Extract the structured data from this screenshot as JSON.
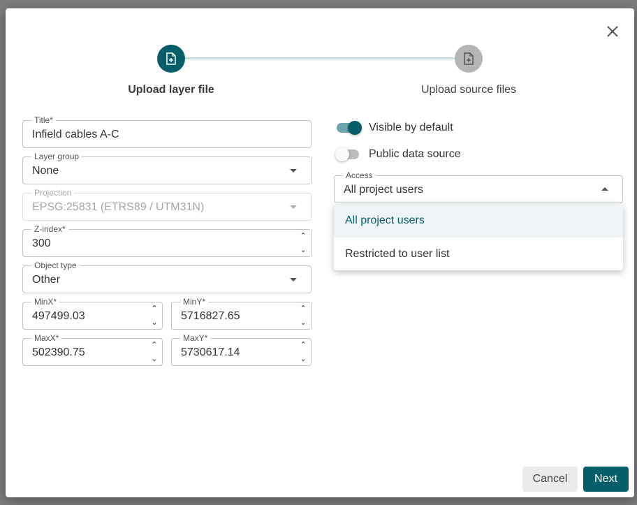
{
  "stepper": {
    "steps": [
      {
        "label": "Upload layer file",
        "state": "active",
        "icon": "file-plus-icon"
      },
      {
        "label": "Upload source files",
        "state": "inactive",
        "icon": "file-plus-icon"
      }
    ]
  },
  "form": {
    "title": {
      "label": "Title*",
      "value": "Infield cables A-C"
    },
    "layer_group": {
      "label": "Layer group",
      "value": "None"
    },
    "projection": {
      "label": "Projection",
      "value": "EPSG:25831 (ETRS89 / UTM31N)",
      "disabled": true
    },
    "z_index": {
      "label": "Z-index*",
      "value": "300"
    },
    "object_type": {
      "label": "Object type",
      "value": "Other"
    },
    "min_x": {
      "label": "MinX*",
      "value": "497499.03"
    },
    "min_y": {
      "label": "MinY*",
      "value": "5716827.65"
    },
    "max_x": {
      "label": "MaxX*",
      "value": "502390.75"
    },
    "max_y": {
      "label": "MaxY*",
      "value": "5730617.14"
    }
  },
  "options": {
    "visible_by_default": {
      "label": "Visible by default",
      "checked": true
    },
    "public_data_source": {
      "label": "Public data source",
      "checked": false
    },
    "access": {
      "label": "Access",
      "value": "All project users",
      "menu": [
        "All project users",
        "Restricted to user list"
      ]
    }
  },
  "buttons": {
    "cancel": "Cancel",
    "next": "Next"
  },
  "colors": {
    "accent": "#075e6b",
    "inactive_step": "#b5b5b5",
    "step_line": "#c9dfe3"
  }
}
